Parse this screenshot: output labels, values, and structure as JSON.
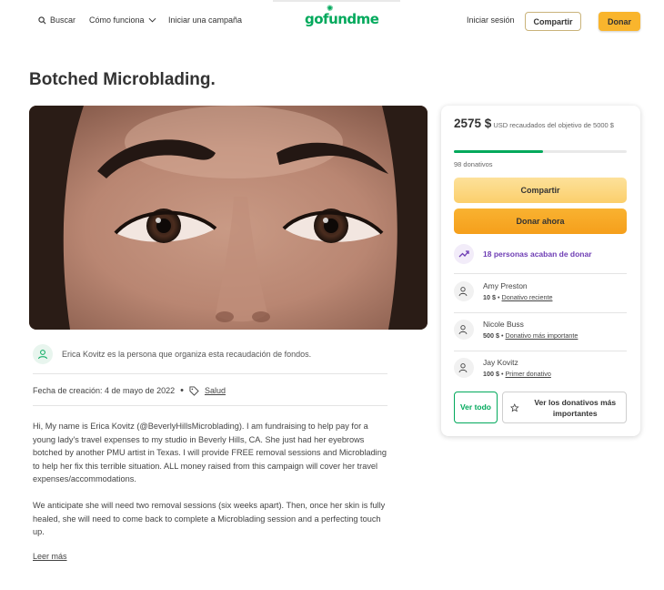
{
  "header": {
    "search_label": "Buscar",
    "how_it_works_label": "Cómo funciona",
    "start_campaign_label": "Iniciar una campaña",
    "logo_text": "gofundme",
    "login_label": "Iniciar sesión",
    "share_label": "Compartir",
    "donate_label": "Donar"
  },
  "campaign": {
    "title": "Botched Microblading.",
    "organizer_text": "Erica Kovitz es la persona que organiza esta recaudación de fondos.",
    "created_label": "Fecha de creación: 4 de mayo de 2022",
    "category": "Salud",
    "story_paragraphs": [
      "Hi, My name is Erica Kovitz (@BeverlyHillsMicroblading).  I am fundraising to help pay for a young lady's travel expenses to my studio in Beverly Hills, CA. She just had her eyebrows botched by another PMU artist in Texas. I will provide FREE removal sessions and Microblading to help her fix this terrible situation. ALL money raised from this campaign will cover her travel expenses/accommodations.",
      "We anticipate she will need two removal sessions (six weeks apart). Then, once her skin is fully healed, she will need to come back to complete a Microblading session and a perfecting touch up."
    ],
    "read_more": "Leer más"
  },
  "donation_card": {
    "amount_raised": "2575 $",
    "goal_text": "USD recaudados del objetivo de 5000 $",
    "progress_fraction": 0.515,
    "donations_count": "98 donativos",
    "share_button": "Compartir",
    "donate_button": "Donar ahora",
    "recent_donors_text": "18 personas acaban de donar",
    "donors": [
      {
        "name": "Amy Preston",
        "amount": "10 $",
        "tag": "Donativo reciente"
      },
      {
        "name": "Nicole Buss",
        "amount": "500 $",
        "tag": "Donativo más importante"
      },
      {
        "name": "Jay Kovitz",
        "amount": "100 $",
        "tag": "Primer donativo"
      }
    ],
    "see_all_button": "Ver todo",
    "see_top_button": "Ver los donativos más importantes"
  },
  "colors": {
    "brand_green": "#02a95c",
    "donate_orange": "#f9b52d",
    "purple": "#6e3db4"
  }
}
